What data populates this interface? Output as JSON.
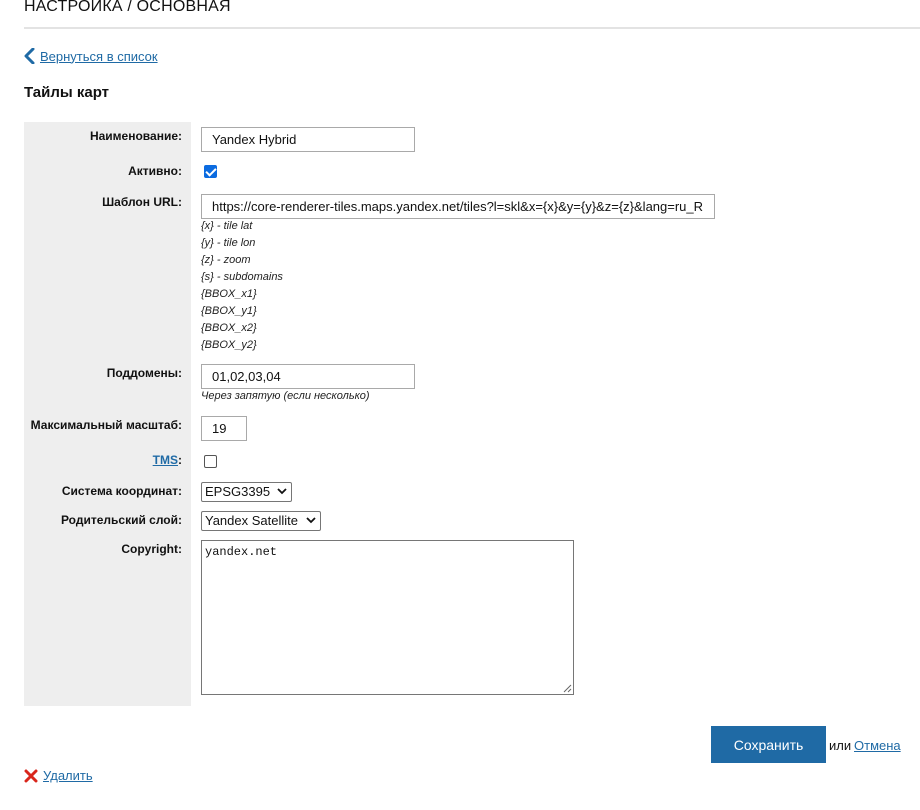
{
  "header": {
    "title": "НАСТРОЙКА / ОСНОВНАЯ"
  },
  "nav": {
    "back_label": "Вернуться в список"
  },
  "section": {
    "title": "Тайлы карт"
  },
  "form": {
    "name": {
      "label": "Наименование:",
      "value": "Yandex Hybrid"
    },
    "active": {
      "label": "Активно:",
      "checked": true
    },
    "url_template": {
      "label": "Шаблон URL:",
      "value": "https://core-renderer-tiles.maps.yandex.net/tiles?l=skl&x={x}&y={y}&z={z}&lang=ru_R",
      "hints": [
        "{x} - tile lat",
        "{y} - tile lon",
        "{z} - zoom",
        "{s} - subdomains",
        "{BBOX_x1}",
        "{BBOX_y1}",
        "{BBOX_x2}",
        "{BBOX_y2}"
      ]
    },
    "subdomains": {
      "label": "Поддомены:",
      "value": "01,02,03,04",
      "hint": "Через запятую (если несколько)"
    },
    "max_zoom": {
      "label": "Максимальный масштаб:",
      "value": "19"
    },
    "tms": {
      "label_link": "TMS",
      "label_suffix": ":",
      "checked": false
    },
    "coord_system": {
      "label": "Система координат:",
      "value": "EPSG3395"
    },
    "parent_layer": {
      "label": "Родительский слой:",
      "value": "Yandex Satellite"
    },
    "copyright": {
      "label": "Copyright:",
      "value": "yandex.net"
    }
  },
  "actions": {
    "save_label": "Сохранить",
    "or_label": "или",
    "cancel_label": "Отмена",
    "delete_label": "Удалить"
  },
  "colors": {
    "accent": "#1f6aa5",
    "delete_icon": "#d9261c",
    "checkbox": "#0b6be0",
    "label_panel": "#eeeeee"
  }
}
